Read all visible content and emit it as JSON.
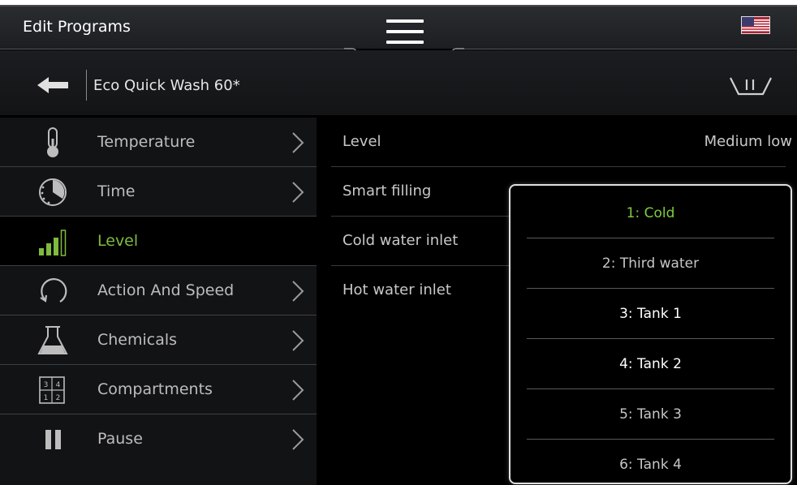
{
  "header": {
    "title": "Edit Programs",
    "menu_icon": "hamburger-menu-icon",
    "flag_icon": "us-flag-icon"
  },
  "program": {
    "name": "Eco Quick Wash 60*",
    "back_icon": "back-arrow-icon",
    "basket_icon": "basket-icon"
  },
  "left_menu": {
    "items": [
      {
        "label": "Temperature",
        "icon": "thermometer-icon",
        "active": false
      },
      {
        "label": "Time",
        "icon": "clock-icon",
        "active": false
      },
      {
        "label": "Level",
        "icon": "level-bars-icon",
        "active": true
      },
      {
        "label": "Action And Speed",
        "icon": "rotation-icon",
        "active": false
      },
      {
        "label": "Chemicals",
        "icon": "flask-icon",
        "active": false
      },
      {
        "label": "Compartments",
        "icon": "compartments-icon",
        "active": false
      },
      {
        "label": "Pause",
        "icon": "pause-icon",
        "active": false
      }
    ]
  },
  "settings": {
    "rows": [
      {
        "label": "Level",
        "value": "Medium low"
      },
      {
        "label": "Smart filling",
        "value": ""
      },
      {
        "label": "Cold water inlet",
        "value": ""
      },
      {
        "label": "Hot water inlet",
        "value": ""
      }
    ]
  },
  "dropdown": {
    "options": [
      {
        "label": "1: Cold",
        "state": "selected"
      },
      {
        "label": "2: Third water",
        "state": "dim"
      },
      {
        "label": "3: Tank 1",
        "state": "bright"
      },
      {
        "label": "4: Tank 2",
        "state": "bright"
      },
      {
        "label": "5: Tank 3",
        "state": "dim"
      },
      {
        "label": "6: Tank 4",
        "state": "dim"
      }
    ]
  },
  "colors": {
    "accent_green": "#7fbb3e",
    "selected_green": "#7fcc40",
    "text_grey": "#bdbdbd"
  }
}
